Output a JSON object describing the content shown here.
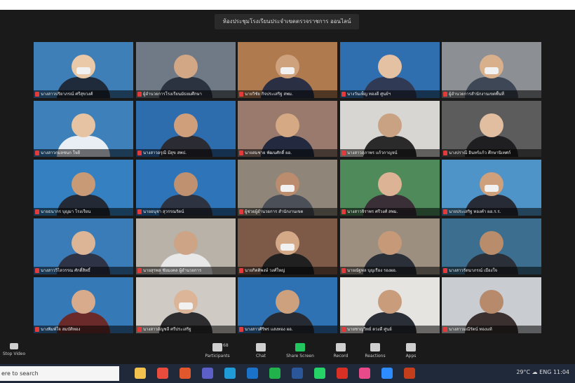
{
  "meeting": {
    "banner_text": "ห้องประชุมโรงเรียนประจำเขตตรวจราชการ ออนไลน์",
    "participants": [
      {
        "name": "นางสาวปริยาภรณ์ ศรีสุขวงศ์",
        "bg": "#3f7fb8",
        "skin": "#e9c9a8",
        "shirt": "#1f2a3a",
        "masked": true
      },
      {
        "name": "ผู้อำนวยการโรงเรียนมัธยมศึกษา",
        "bg": "#6f7a86",
        "skin": "#d2a785",
        "shirt": "#2b3340",
        "masked": false
      },
      {
        "name": "นายวิชัย กิจประเสริฐ สพม.",
        "bg": "#b07a4f",
        "skin": "#cfa27e",
        "shirt": "#2a2f44",
        "masked": true
      },
      {
        "name": "นางวันเพ็ญ ทองดี ศูนย์ฯ",
        "bg": "#2f6fb0",
        "skin": "#e3c1a2",
        "shirt": "#303a55",
        "masked": false
      },
      {
        "name": "ผู้อำนวยการสำนักงานเขตพื้นที่",
        "bg": "#8c8f93",
        "skin": "#d9b08c",
        "shirt": "#3d4756",
        "masked": true
      },
      {
        "name": "นางสาวกมลชนก ใจดี",
        "bg": "#3e80ba",
        "skin": "#e6c3a3",
        "shirt": "#e8eef4",
        "masked": false
      },
      {
        "name": "นางสาวอรุณี มีสุข สพป.",
        "bg": "#2d6cad",
        "skin": "#cf9f7b",
        "shirt": "#2b2b33",
        "masked": false
      },
      {
        "name": "นายสมชาย พัฒนศักดิ์ ผอ.",
        "bg": "#9a7a6d",
        "skin": "#d4a984",
        "shirt": "#232a3f",
        "masked": false
      },
      {
        "name": "นางสาวสุภาพร แก้วกาญจน์",
        "bg": "#d8d6d2",
        "skin": "#c9a283",
        "shirt": "#2a2a2a",
        "masked": false
      },
      {
        "name": "นางปราณี อินทร์แก้ว ศึกษานิเทศก์",
        "bg": "#5c5c5c",
        "skin": "#e1bea0",
        "shirt": "#1f1f22",
        "masked": false
      },
      {
        "name": "นายธนากร บุญมา โรงเรียน",
        "bg": "#3480c0",
        "skin": "#c99a76",
        "shirt": "#232a36",
        "masked": false
      },
      {
        "name": "นายอนุชา สุวรรณรัตน์",
        "bg": "#2e74b8",
        "skin": "#bf9170",
        "shirt": "#2d3340",
        "masked": false
      },
      {
        "name": "ผู้ช่วยผู้อำนวยการ สำนักงานเขต",
        "bg": "#8f8578",
        "skin": "#bb8c6d",
        "shirt": "#4a4f58",
        "masked": true
      },
      {
        "name": "นางสาวจิราพร ศรีวงศ์ สพม.",
        "bg": "#4f8a5a",
        "skin": "#dcb394",
        "shirt": "#3a2f36",
        "masked": false
      },
      {
        "name": "นายประเสริฐ ทองคำ ผอ.ร.ร.",
        "bg": "#4f94c8",
        "skin": "#cfa07c",
        "shirt": "#262b35",
        "masked": true
      },
      {
        "name": "นางสาววิไลวรรณ ศักดิ์สิทธิ์",
        "bg": "#3a7cb8",
        "skin": "#dcb597",
        "shirt": "#2e3445",
        "masked": false
      },
      {
        "name": "นายสุรพล ชัยมงคล ผู้อำนวยการ",
        "bg": "#b8b2a8",
        "skin": "#cda486",
        "shirt": "#e8e8e8",
        "masked": false
      },
      {
        "name": "นายกิตติพงษ์ วงศ์ใหญ่",
        "bg": "#7d5a48",
        "skin": "#d3a987",
        "shirt": "#202020",
        "masked": true
      },
      {
        "name": "นายณัฐพล บุญเรือง รองผอ.",
        "bg": "#9c8f80",
        "skin": "#c69a78",
        "shirt": "#2a2f38",
        "masked": false
      },
      {
        "name": "นางสาวรัตนาภรณ์ เมืองใจ",
        "bg": "#3c6f8f",
        "skin": "#b98d6c",
        "shirt": "#2a2f38",
        "masked": false
      },
      {
        "name": "นางพิมพ์ใจ สมบัติทอง",
        "bg": "#3579b6",
        "skin": "#d7ab8c",
        "shirt": "#6b2a2a",
        "masked": false
      },
      {
        "name": "นางสาวอัญชลี ศรีประเสริฐ",
        "bg": "#cfcac3",
        "skin": "#dcb599",
        "shirt": "#2d2d30",
        "masked": true
      },
      {
        "name": "นางสาวศิริพร แสงทอง ผอ.",
        "bg": "#2f72b4",
        "skin": "#cda07e",
        "shirt": "#262a33",
        "masked": false
      },
      {
        "name": "นายชาญวิทย์ ดวงดี ศูนย์",
        "bg": "#e6e4e1",
        "skin": "#c99c7b",
        "shirt": "#2a2e37",
        "masked": false
      },
      {
        "name": "นางสาวมณีรัตน์ ทองแท้",
        "bg": "#c9ccd1",
        "skin": "#b68a6b",
        "shirt": "#3a3030",
        "masked": false
      }
    ]
  },
  "controls": {
    "items": [
      {
        "label": "Participants",
        "color": "#cfcfcf"
      },
      {
        "label": "Chat",
        "color": "#cfcfcf"
      },
      {
        "label": "Share Screen",
        "color": "#22c55e"
      },
      {
        "label": "Record",
        "color": "#cfcfcf"
      },
      {
        "label": "Reactions",
        "color": "#cfcfcf"
      },
      {
        "label": "Apps",
        "color": "#cfcfcf"
      }
    ],
    "participant_count": "68"
  },
  "taskbar": {
    "search_text": "ere to search",
    "icons": [
      {
        "name": "file-explorer-icon",
        "color": "#f2c14e"
      },
      {
        "name": "chrome-icon",
        "color": "#e94b3c"
      },
      {
        "name": "office-icon",
        "color": "#e2572b"
      },
      {
        "name": "teams-icon",
        "color": "#5b5fc7"
      },
      {
        "name": "edge-icon",
        "color": "#1f9bd8"
      },
      {
        "name": "outlook-icon",
        "color": "#1a73c8"
      },
      {
        "name": "line-icon",
        "color": "#22b24c"
      },
      {
        "name": "word-icon",
        "color": "#2b579a"
      },
      {
        "name": "whatsapp-icon",
        "color": "#25d366"
      },
      {
        "name": "acrobat-icon",
        "color": "#d93025"
      },
      {
        "name": "photos-icon",
        "color": "#e84a8a"
      },
      {
        "name": "zoom-icon",
        "color": "#2d8cff"
      },
      {
        "name": "powerpoint-icon",
        "color": "#c43e1c"
      }
    ],
    "tray_text": "29°C  ☁  ENG  11:04"
  }
}
